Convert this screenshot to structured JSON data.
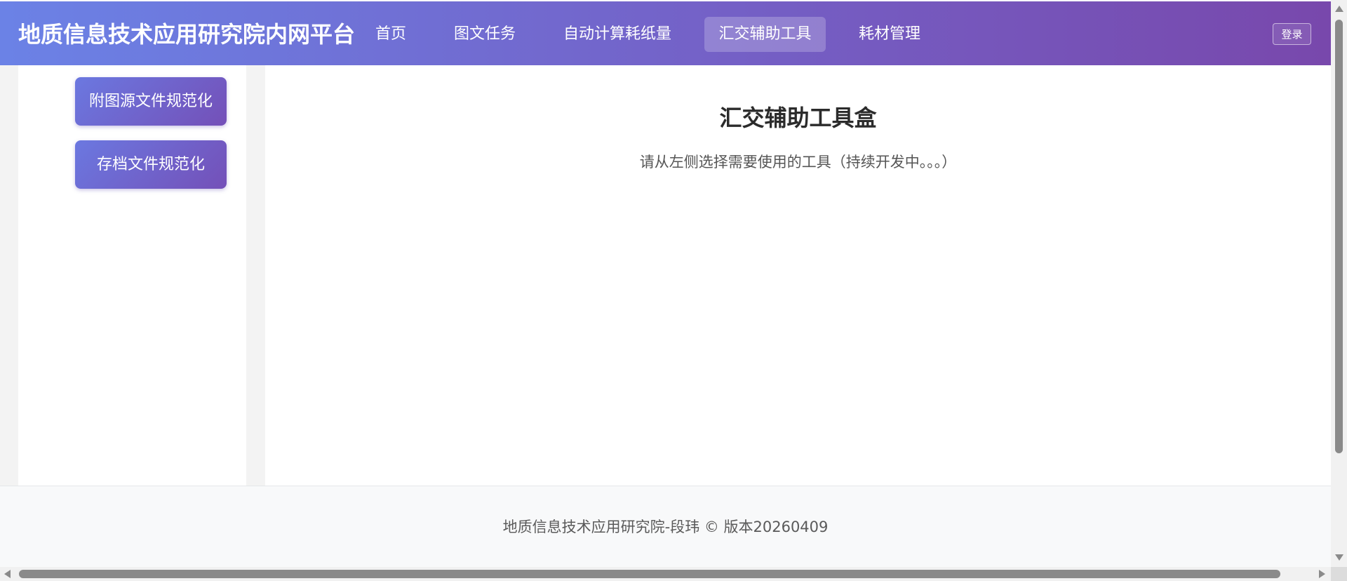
{
  "header": {
    "brand": "地质信息技术应用研究院内网平台",
    "nav": [
      {
        "label": "首页",
        "active": false
      },
      {
        "label": "图文任务",
        "active": false
      },
      {
        "label": "自动计算耗纸量",
        "active": false
      },
      {
        "label": "汇交辅助工具",
        "active": true
      },
      {
        "label": "耗材管理",
        "active": false
      }
    ],
    "login_label": "登录"
  },
  "sidebar": {
    "buttons": [
      {
        "label": "附图源文件规范化"
      },
      {
        "label": "存档文件规范化"
      }
    ]
  },
  "main": {
    "title": "汇交辅助工具盒",
    "subtitle": "请从左侧选择需要使用的工具（持续开发中。。。）"
  },
  "footer": {
    "text": "地质信息技术应用研究院-段玮 © 版本20260409"
  },
  "colors": {
    "header_gradient_start": "#6b82e6",
    "header_gradient_end": "#7848ac",
    "button_gradient_start": "#6b78e0",
    "button_gradient_end": "#7450b8"
  }
}
